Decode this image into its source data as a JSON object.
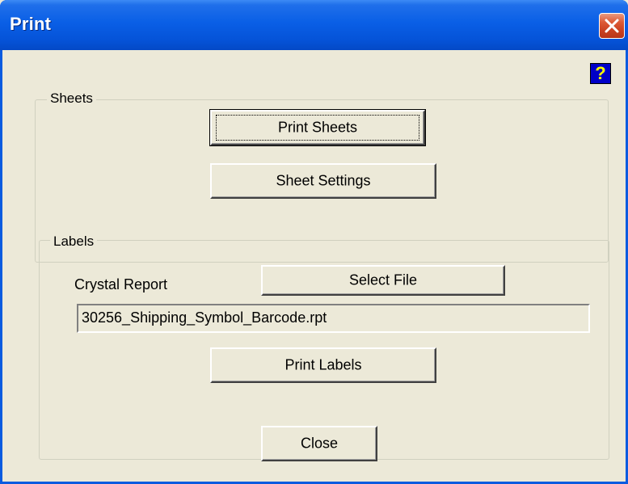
{
  "window": {
    "title": "Print"
  },
  "help": {
    "glyph": "?"
  },
  "sheets": {
    "legend": "Sheets",
    "print_button": "Print Sheets",
    "settings_button": "Sheet Settings"
  },
  "labels": {
    "legend": "Labels",
    "report_label": "Crystal Report",
    "select_file_button": "Select File",
    "file_value": "30256_Shipping_Symbol_Barcode.rpt",
    "print_button": "Print Labels"
  },
  "footer": {
    "close_button": "Close"
  },
  "icons": {
    "close": "close-icon",
    "help": "help-icon"
  },
  "colors": {
    "titlebar": "#0a5fe6",
    "client_bg": "#ece9d8",
    "close_button": "#d2492a",
    "help_bg": "#0000c8",
    "help_fg": "#ffff00"
  }
}
